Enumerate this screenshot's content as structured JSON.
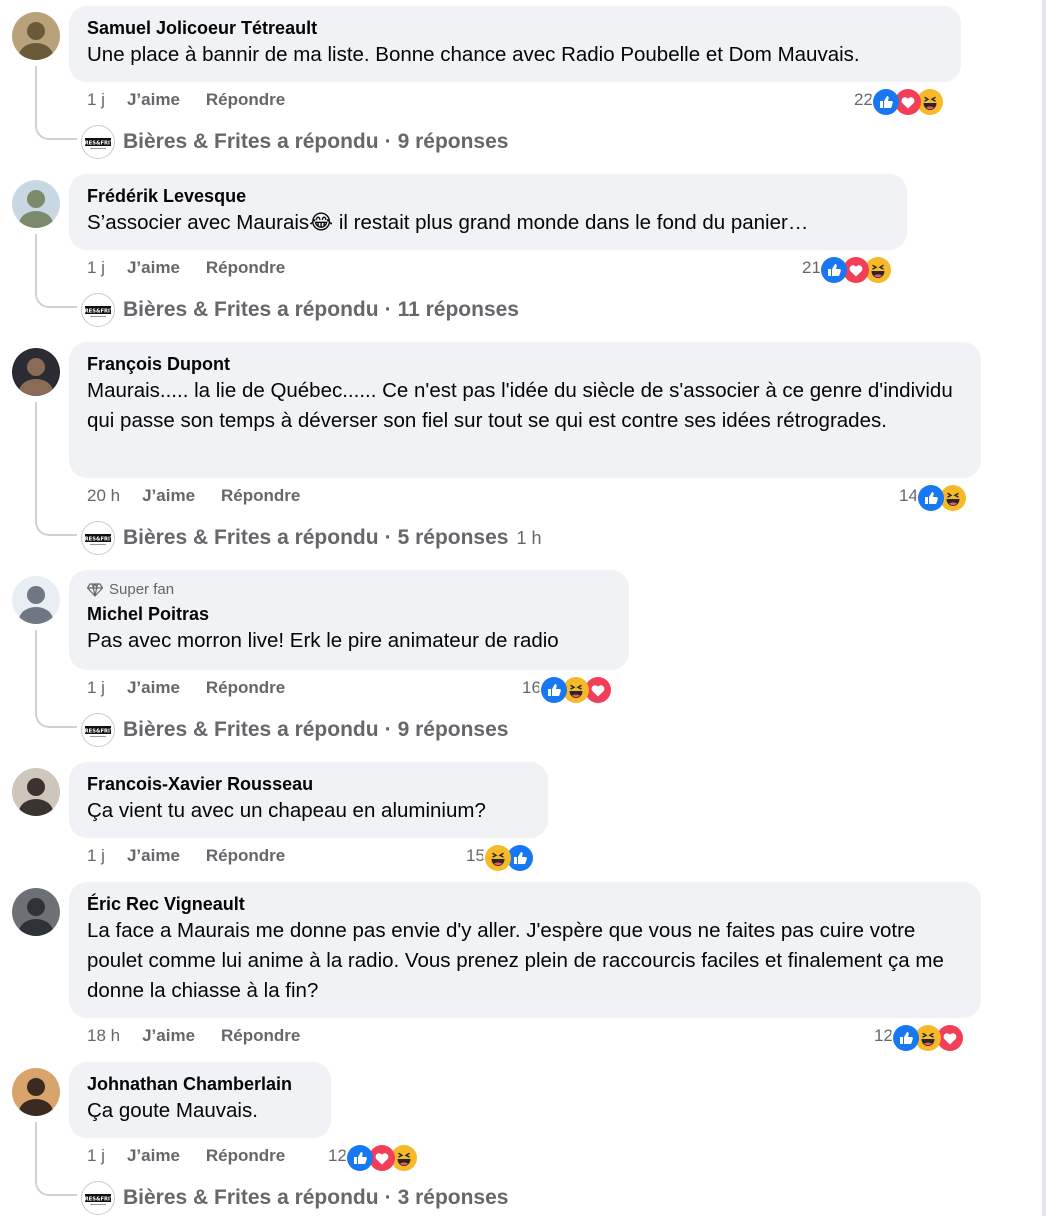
{
  "colors": {
    "bubble_bg": "#f0f2f5",
    "meta_text": "#65676b",
    "like_blue": "#1877f2",
    "love_red": "#f33e58",
    "haha_yellow": "#f7b928"
  },
  "comments": [
    {
      "author": "Samuel Jolicoeur Tétreault",
      "superfan": "",
      "text": "Une place à bannir de ma liste. Bonne chance avec Radio Poubelle et Dom Mauvais.",
      "time": "1 j",
      "like_label": "J’aime",
      "reply_label": "Répondre",
      "reaction_count": "22",
      "reactions": [
        "like-icon",
        "love-icon",
        "haha-icon"
      ],
      "replies": {
        "page": "Bières & Frites a répondu",
        "count": "9 réponses",
        "time": ""
      }
    },
    {
      "author": "Frédérik Levesque",
      "superfan": "",
      "text": "S’associer avec Maurais😂 il restait plus grand monde dans le fond du panier…",
      "time": "1 j",
      "like_label": "J’aime",
      "reply_label": "Répondre",
      "reaction_count": "21",
      "reactions": [
        "like-icon",
        "love-icon",
        "haha-icon"
      ],
      "replies": {
        "page": "Bières & Frites a répondu",
        "count": "11 réponses",
        "time": ""
      }
    },
    {
      "author": "François Dupont",
      "superfan": "",
      "text": "Maurais..... la lie de Québec...... Ce n'est pas l'idée du siècle de s'associer à ce genre d'individu qui passe son temps à déverser son fiel sur tout se qui est contre ses idées rétrogrades.",
      "time": "20 h",
      "like_label": "J’aime",
      "reply_label": "Répondre",
      "reaction_count": "14",
      "reactions": [
        "like-icon",
        "haha-icon"
      ],
      "replies": {
        "page": "Bières & Frites a répondu",
        "count": "5 réponses",
        "time": "1 h"
      }
    },
    {
      "author": "Michel Poitras",
      "superfan": "Super fan",
      "text": "Pas avec morron live! Erk le pire animateur de radio",
      "time": "1 j",
      "like_label": "J’aime",
      "reply_label": "Répondre",
      "reaction_count": "16",
      "reactions": [
        "like-icon",
        "haha-icon",
        "love-icon"
      ],
      "replies": {
        "page": "Bières & Frites a répondu",
        "count": "9 réponses",
        "time": ""
      }
    },
    {
      "author": "Francois-Xavier Rousseau",
      "superfan": "",
      "text": "Ça vient tu avec un chapeau en aluminium?",
      "time": "1 j",
      "like_label": "J’aime",
      "reply_label": "Répondre",
      "reaction_count": "15",
      "reactions": [
        "haha-icon",
        "like-icon"
      ],
      "replies": null
    },
    {
      "author": "Éric Rec Vigneault",
      "superfan": "",
      "text": "La face a Maurais me donne pas envie d'y aller. J'espère que vous ne faites pas cuire votre poulet comme lui anime à la radio. Vous prenez plein de raccourcis faciles et finalement ça me donne la chiasse à la fin?",
      "time": "18 h",
      "like_label": "J’aime",
      "reply_label": "Répondre",
      "reaction_count": "12",
      "reactions": [
        "like-icon",
        "haha-icon",
        "love-icon"
      ],
      "replies": null
    },
    {
      "author": "Johnathan Chamberlain",
      "superfan": "",
      "text": "Ça goute Mauvais.",
      "time": "1 j",
      "like_label": "J’aime",
      "reply_label": "Répondre",
      "reaction_count": "12",
      "reactions": [
        "like-icon",
        "love-icon",
        "haha-icon"
      ],
      "replies": {
        "page": "Bières & Frites a répondu",
        "count": "3 réponses",
        "time": ""
      }
    }
  ]
}
